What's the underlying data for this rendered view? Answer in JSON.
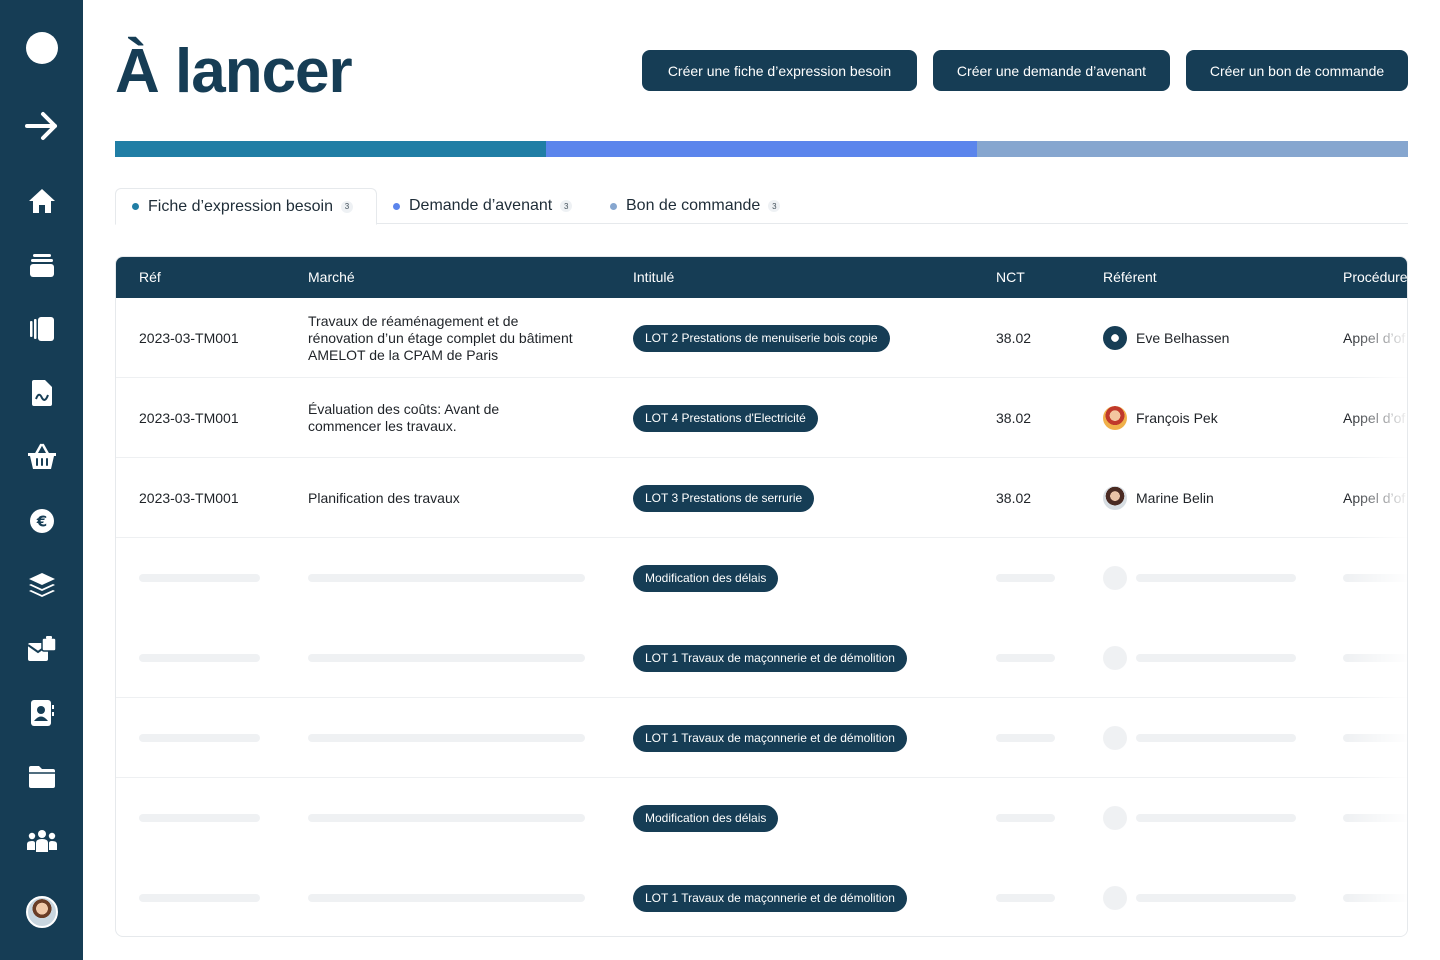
{
  "page": {
    "title": "À lancer"
  },
  "header": {
    "buttons": [
      {
        "label": "Créer une fiche d’expression besoin"
      },
      {
        "label": "Créer une demande d’avenant"
      },
      {
        "label": "Créer un bon de commande"
      }
    ]
  },
  "progress": {
    "segments": [
      {
        "name": "Fiche d’expression besoin",
        "share": 0.3333,
        "color": "#207ea5"
      },
      {
        "name": "Demande d’avenant",
        "share": 0.3333,
        "color": "#5b85ec"
      },
      {
        "name": "Bon de commande",
        "share": 0.3334,
        "color": "#86a6cf"
      }
    ]
  },
  "tabs": [
    {
      "label": "Fiche d’expression besoin",
      "count": "3",
      "color": "#207ea5",
      "active": true
    },
    {
      "label": "Demande d’avenant",
      "count": "3",
      "color": "#5b85ec",
      "active": false
    },
    {
      "label": "Bon de commande",
      "count": "3",
      "color": "#86a6cf",
      "active": false
    }
  ],
  "table": {
    "columns": [
      "Réf",
      "Marché",
      "Intitulé",
      "NCT",
      "Référent",
      "Procédure"
    ],
    "rows": [
      {
        "ref": "2023-03-TM001",
        "marche": "Travaux de réaménagement et de rénovation d’un étage complet du bâtiment AMELOT de la CPAM de Paris",
        "intitule": "LOT 2 Prestations de menuiserie bois copie",
        "nct": "38.02",
        "referent": "Eve Belhassen",
        "procedure": "Appel d’of"
      },
      {
        "ref": "2023-03-TM001",
        "marche": "Évaluation des coûts: Avant de commencer les travaux.",
        "intitule": "LOT 4 Prestations d'Electricité",
        "nct": "38.02",
        "referent": "François Pek",
        "procedure": "Appel d’of"
      },
      {
        "ref": "2023-03-TM001",
        "marche": "Planification des travaux",
        "intitule": "LOT 3 Prestations de serrurie",
        "nct": "38.02",
        "referent": "Marine Belin",
        "procedure": "Appel d’of"
      }
    ],
    "placeholder_rows": [
      {
        "intitule": "Modification des délais"
      },
      {
        "intitule": "LOT 1 Travaux de maçonnerie et de démolition"
      },
      {
        "intitule": "LOT 1 Travaux de maçonnerie et de démolition"
      },
      {
        "intitule": "Modification des délais"
      },
      {
        "intitule": "LOT 1 Travaux de maçonnerie et de démolition"
      }
    ]
  },
  "sidebar": {
    "items": [
      "logo-icon",
      "arrow-right-icon",
      "home-icon",
      "archive-icon",
      "book-icon",
      "document-icon",
      "basket-icon",
      "euro-icon",
      "layers-icon",
      "mail-briefcase-icon",
      "contacts-icon",
      "folder-icon",
      "users-icon",
      "user-avatar"
    ]
  },
  "colors": {
    "primary": "#163d55",
    "accent": "#207ea5",
    "blue": "#5b85ec",
    "light_blue": "#86a6cf"
  }
}
